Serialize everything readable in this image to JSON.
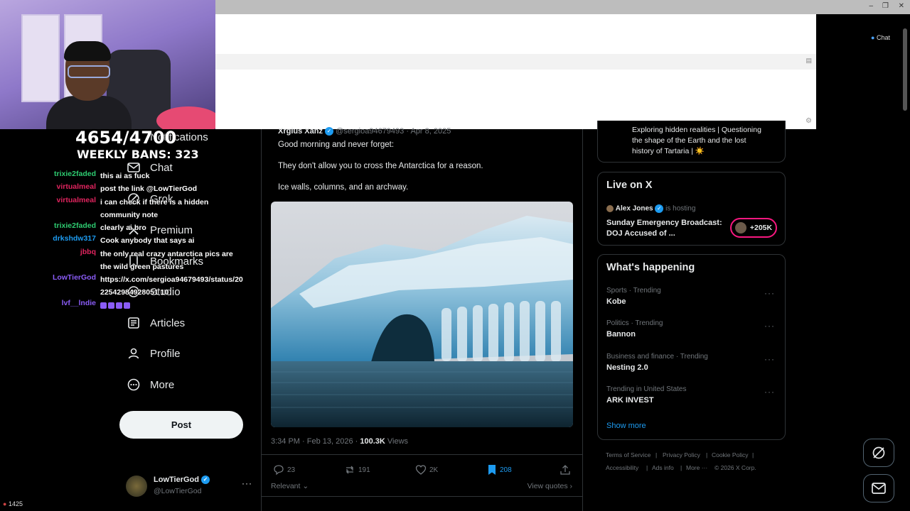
{
  "overlay": {
    "count": "4654/4700",
    "weekly_bans": "WEEKLY BANS: 323",
    "viewer_count": "1425"
  },
  "chat": [
    {
      "user": "trixie2faded",
      "msg": "this ai as fuck",
      "color": "#2ecc71"
    },
    {
      "user": "virtualmeal",
      "msg": "post the link @LowTierGod",
      "color": "#e0245e"
    },
    {
      "user": "virtualmeal",
      "msg": "i can check if there is a hidden community note",
      "color": "#e0245e"
    },
    {
      "user": "trixie2faded",
      "msg": "clearly ai bro",
      "color": "#2ecc71"
    },
    {
      "user": "drkshdw317",
      "msg": "Cook anybody that says ai",
      "color": "#1d9bf0"
    },
    {
      "user": "jbbq",
      "msg": "the only real crazy antarctica pics are the wild green pastures",
      "color": "#e0245e"
    },
    {
      "user": "LowTierGod",
      "msg": "https://x.com/sergioa94679493/status/2022542984928051 10",
      "color": "#8a5cf6"
    },
    {
      "user": "lvf__lndie",
      "msg": "",
      "color": "#8a5cf6"
    }
  ],
  "nav": {
    "notifications": "Notifications",
    "chat": "Chat",
    "grok": "Grok",
    "premium": "Premium",
    "bookmarks": "Bookmarks",
    "studio": "Studio",
    "articles": "Articles",
    "profile": "Profile",
    "more": "More",
    "post": "Post"
  },
  "account": {
    "name": "LowTierGod",
    "handle": "@LowTierGod"
  },
  "tweet": {
    "author": "Xrgius Xanz",
    "handle": "@sergioa94679493",
    "date": "· Apr 8, 2025",
    "line1": "Good morning and never forget:",
    "line2": "They don't allow you to cross the Antarctica for a reason.",
    "line3": "Ice walls, columns, and an archway.",
    "timestamp": "3:34 PM · Feb 13, 2026 ·",
    "views_count": "100.3K",
    "views_label": "Views",
    "replies": "23",
    "reposts": "191",
    "likes": "2K",
    "bookmarks": "208",
    "sort": "Relevant",
    "view_quotes": "View quotes"
  },
  "bio_snippet": {
    "line1": "Exploring hidden realities | Questioning",
    "line2": "the shape of the Earth and the lost",
    "line3": "history of Tartaria | ☀️"
  },
  "live": {
    "heading": "Live on X",
    "host": "Alex Jones",
    "hosting": "is hosting",
    "title": "Sunday Emergency Broadcast: DOJ Accused of ...",
    "listeners": "+205K"
  },
  "happening": {
    "heading": "What's happening",
    "trends": [
      {
        "category": "Sports · Trending",
        "name": "Kobe"
      },
      {
        "category": "Politics · Trending",
        "name": "Bannon"
      },
      {
        "category": "Business and finance · Trending",
        "name": "Nesting 2.0"
      },
      {
        "category": "Trending in United States",
        "name": "ARK INVEST"
      }
    ],
    "show_more": "Show more"
  },
  "footer": {
    "terms": "Terms of Service",
    "privacy": "Privacy Policy",
    "cookie": "Cookie Policy",
    "accessibility": "Accessibility",
    "ads": "Ads info",
    "more": "More ···",
    "copyright": "© 2026 X Corp."
  },
  "browser": {
    "chat_label": "Chat"
  },
  "colors": {
    "accent": "#1d9bf0",
    "background": "#000000",
    "border": "#2f3336"
  }
}
